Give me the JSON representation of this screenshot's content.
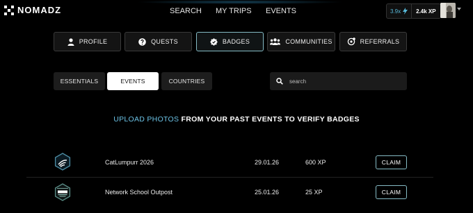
{
  "brand": {
    "name": "NOMADZ"
  },
  "nav": [
    "SEARCH",
    "MY TRIPS",
    "EVENTS"
  ],
  "stats": {
    "multiplier": "3.9x",
    "xp": "2.4k XP"
  },
  "tabs": [
    {
      "label": "PROFILE",
      "icon": "person-icon"
    },
    {
      "label": "QUESTS",
      "icon": "quest-icon"
    },
    {
      "label": "BADGES",
      "icon": "badge-icon",
      "active": true
    },
    {
      "label": "COMMUNITIES",
      "icon": "group-icon"
    },
    {
      "label": "REFERRALS",
      "icon": "referral-icon"
    }
  ],
  "subtabs": [
    {
      "label": "ESSENTIALS",
      "active": false
    },
    {
      "label": "EVENTS",
      "active": true
    },
    {
      "label": "COUNTRIES",
      "active": false
    }
  ],
  "search": {
    "placeholder": "search",
    "value": ""
  },
  "headline": {
    "accent": "UPLOAD PHOTOS",
    "rest": " FROM YOUR PAST EVENTS TO VERIFY BADGES"
  },
  "events": [
    {
      "name": "CatLumpurr 2026",
      "date": "29.01.26",
      "xp": "600 XP",
      "action": "CLAIM",
      "icon": "wifi-hex-badge-icon"
    },
    {
      "name": "Network School Outpost",
      "date": "25.01.26",
      "xp": "25 XP",
      "action": "CLAIM",
      "icon": "outpost-hex-badge-icon"
    }
  ],
  "colors": {
    "accent": "#6cc3e6",
    "active_border": "#86bcc6",
    "background": "#000000"
  }
}
